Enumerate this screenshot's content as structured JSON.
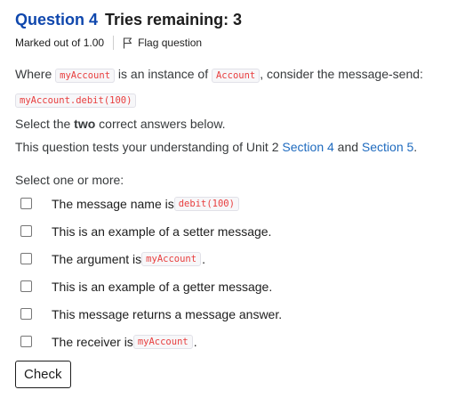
{
  "question": {
    "number": "Question 4",
    "tries": "Tries remaining: 3",
    "marked": "Marked out of 1.00",
    "flag_label": "Flag question"
  },
  "text": {
    "p1_a": "Where ",
    "p1_code1": "myAccount",
    "p1_b": " is an instance of ",
    "p1_code2": "Account",
    "p1_c": ", consider the message-send:",
    "p1_code3": "myAccount.debit(100)",
    "p2_a": "Select the ",
    "p2_bold": "two",
    "p2_b": " correct answers below.",
    "p3_a": "This question tests your understanding of Unit 2 ",
    "p3_link1": "Section 4",
    "p3_b": " and ",
    "p3_link2": "Section 5",
    "p3_c": "."
  },
  "select_label": "Select one or more:",
  "answers": [
    {
      "text": "The message name is ",
      "code": "debit(100)",
      "suffix": ""
    },
    {
      "text": "This is an example of a setter message.",
      "code": "",
      "suffix": ""
    },
    {
      "text": "The argument is ",
      "code": "myAccount",
      "suffix": "."
    },
    {
      "text": "This is an example of a getter message.",
      "code": "",
      "suffix": ""
    },
    {
      "text": "This message returns a message answer.",
      "code": "",
      "suffix": ""
    },
    {
      "text": "The receiver is ",
      "code": "myAccount",
      "suffix": "."
    }
  ],
  "check_label": "Check",
  "colors": {
    "heading": "#0f47ad",
    "link": "#1f6bbf",
    "code_text": "#e83e3e"
  }
}
